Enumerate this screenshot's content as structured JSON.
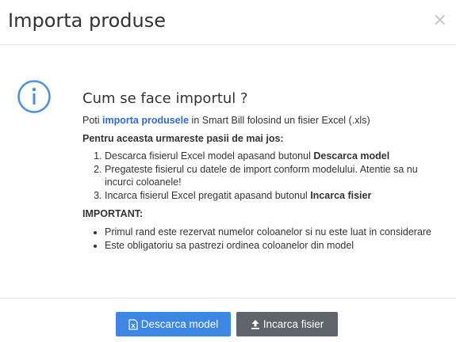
{
  "dialog": {
    "title": "Importa produse",
    "close_icon": "×"
  },
  "info": {
    "heading": "Cum se face importul ?",
    "intro_prefix": "Poti ",
    "intro_link": "importa produsele",
    "intro_suffix": " in Smart Bill folosind un fisier Excel (.xls)",
    "steps_title": "Pentru aceasta urmareste pasii de mai jos:",
    "steps": [
      {
        "text": "Descarca fisierul Excel model apasand butonul ",
        "bold": "Descarca model"
      },
      {
        "text": "Pregateste fisierul cu datele de import conform modelului. Atentie sa nu incurci coloanele!",
        "bold": ""
      },
      {
        "text": "Incarca fisierul Excel pregatit apasand butonul ",
        "bold": "Incarca fisier"
      }
    ],
    "important_title": "IMPORTANT:",
    "notes": [
      "Primul rand este rezervat numelor coloanelor si nu este luat in considerare",
      "Este obligatoriu sa pastrezi ordinea coloanelor din model"
    ]
  },
  "footer": {
    "download_label": "Descarca model",
    "upload_label": "Incarca fisier"
  },
  "colors": {
    "accent": "#3c86e4",
    "secondary": "#5f636a",
    "link": "#2f6bd1",
    "info_icon": "#4a90e2"
  },
  "icons": {
    "info": "info-circle-icon",
    "download": "excel-file-icon",
    "upload": "upload-icon",
    "close": "close-icon"
  }
}
